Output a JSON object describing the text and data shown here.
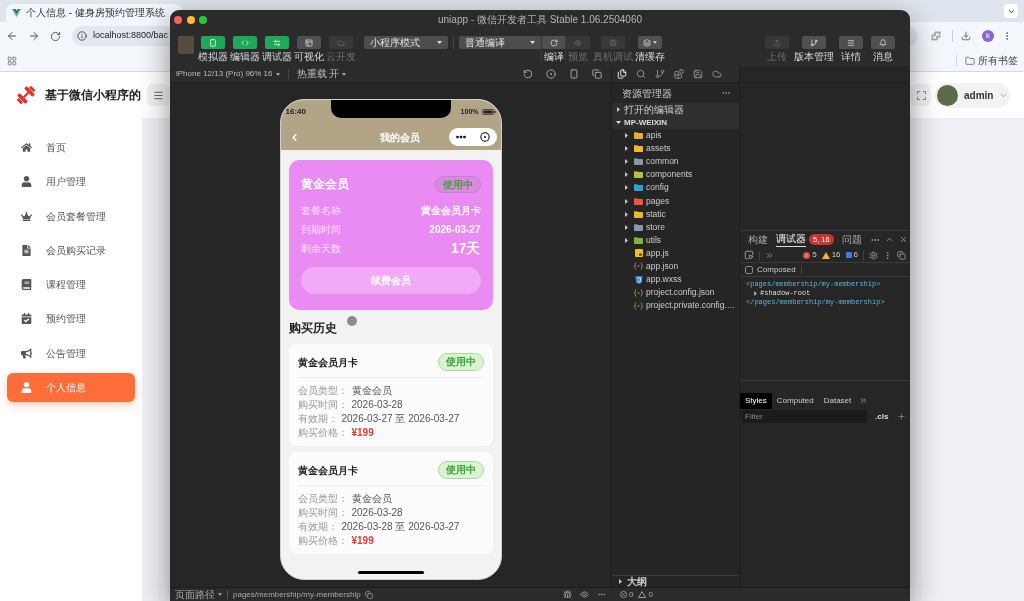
{
  "browser": {
    "tab_title": "个人信息 - 健身房预约管理系统",
    "url": "localhost:8800/bac",
    "profile_initial": "k",
    "bookmarks_folder": "所有书签"
  },
  "app": {
    "title": "基于微信小程序的",
    "user": "admin",
    "menu": [
      {
        "label": "首页",
        "selected": false
      },
      {
        "label": "用户管理",
        "selected": false
      },
      {
        "label": "会员套餐管理",
        "selected": false
      },
      {
        "label": "会员购买记录",
        "selected": false
      },
      {
        "label": "课程管理",
        "selected": false
      },
      {
        "label": "预约管理",
        "selected": false
      },
      {
        "label": "公告管理",
        "selected": false
      },
      {
        "label": "个人信息",
        "selected": true
      }
    ]
  },
  "devtools": {
    "title": "uniapp - 微信开发者工具 Stable 1.06.2504060",
    "toolbar": {
      "view_buttons": [
        {
          "label": "模拟器",
          "on": true,
          "disabled": false
        },
        {
          "label": "编辑器",
          "on": true,
          "disabled": false
        },
        {
          "label": "调试器",
          "on": true,
          "disabled": false
        },
        {
          "label": "可视化",
          "on": false,
          "disabled": false
        },
        {
          "label": "云开发",
          "on": false,
          "disabled": true
        }
      ],
      "mode_select": "小程序模式",
      "compile_select": "普通编译",
      "compile_buttons": [
        {
          "label": "编译",
          "disabled": false
        },
        {
          "label": "预览",
          "disabled": true
        }
      ],
      "debug_buttons": [
        {
          "label": "真机调试",
          "disabled": true
        },
        {
          "label": "清缓存",
          "disabled": false
        }
      ],
      "right_buttons": [
        {
          "label": "上传",
          "disabled": true
        },
        {
          "label": "版本管理",
          "disabled": false
        },
        {
          "label": "详情",
          "disabled": false
        },
        {
          "label": "消息",
          "disabled": false
        }
      ]
    },
    "simulator": {
      "device": "iPhone 12/13 (Pro) 96% 16",
      "hot_reload": "热重载 开",
      "phone": {
        "time": "16:40",
        "battery": "100%",
        "nav_title": "我的会员",
        "membership": {
          "name": "黄金会员",
          "status": "使用中",
          "rows": [
            {
              "label": "套餐名称",
              "value": "黄金会员月卡",
              "kind": "plain"
            },
            {
              "label": "到期时间",
              "value": "2026-03-27",
              "kind": "plain"
            },
            {
              "label": "剩余天数",
              "value": "17天",
              "kind": "large"
            }
          ],
          "button": "续费会员"
        },
        "history_title": "购买历史",
        "history": [
          {
            "title": "黄金会员月卡",
            "status": "使用中",
            "rows": [
              {
                "label": "会员类型：",
                "value": "黄金会员",
                "kind": "plain"
              },
              {
                "label": "购买时间：",
                "value": "2026-03-28",
                "kind": "plain"
              },
              {
                "label": "有效期：",
                "value": "2026-03-27 至 2026-03-27",
                "kind": "plain"
              },
              {
                "label": "购买价格：",
                "value": "¥199",
                "kind": "price"
              }
            ]
          },
          {
            "title": "黄金会员月卡",
            "status": "使用中",
            "rows": [
              {
                "label": "会员类型：",
                "value": "黄金会员",
                "kind": "plain"
              },
              {
                "label": "购买时间：",
                "value": "2026-03-28",
                "kind": "plain"
              },
              {
                "label": "有效期：",
                "value": "2026-03-28 至 2026-03-27",
                "kind": "plain"
              },
              {
                "label": "购买价格：",
                "value": "¥199",
                "kind": "price"
              }
            ]
          }
        ]
      }
    },
    "explorer": {
      "title": "资源管理器",
      "open_editors": {
        "label": "打开的编辑器",
        "expanded": false
      },
      "project": {
        "label": "MP-WEIXIN",
        "expanded": true,
        "children": [
          {
            "name": "apis",
            "kind": "folder",
            "color": "#e9a93b",
            "expanded": false
          },
          {
            "name": "assets",
            "kind": "folder",
            "color": "#f1b533",
            "expanded": false
          },
          {
            "name": "common",
            "kind": "folder",
            "color": "#8797ab",
            "expanded": false
          },
          {
            "name": "components",
            "kind": "folder",
            "color": "#b3c43a",
            "expanded": false
          },
          {
            "name": "config",
            "kind": "folder",
            "color": "#2fa6c8",
            "expanded": false
          },
          {
            "name": "pages",
            "kind": "folder",
            "color": "#e8573e",
            "expanded": false
          },
          {
            "name": "static",
            "kind": "folder",
            "color": "#f0b530",
            "expanded": false
          },
          {
            "name": "store",
            "kind": "folder",
            "color": "#8797ab",
            "expanded": false
          },
          {
            "name": "utils",
            "kind": "folder",
            "color": "#7cb342",
            "expanded": false
          },
          {
            "name": "app.js",
            "kind": "js"
          },
          {
            "name": "app.json",
            "kind": "json"
          },
          {
            "name": "app.wxss",
            "kind": "wxss"
          },
          {
            "name": "project.config.json",
            "kind": "json"
          },
          {
            "name": "project.private.config.…",
            "kind": "json"
          }
        ]
      },
      "outline": {
        "label": "大纲",
        "expanded": false
      }
    },
    "debugger": {
      "tabs": [
        {
          "label": "构建",
          "selected": false
        },
        {
          "label": "调试器",
          "selected": true,
          "badge": "5, 16"
        },
        {
          "label": "问题",
          "selected": false
        }
      ],
      "counts": {
        "errors": "5",
        "warnings": "16",
        "info": "6"
      },
      "composed": {
        "label": "Composed",
        "checked": false
      },
      "elements": [
        {
          "text": "<pages/membership/my-membership>",
          "kind": "tag"
        },
        {
          "text": "#shadow-root",
          "kind": "shadow",
          "expanded": false
        },
        {
          "text": "</pages/membership/my-membership>",
          "kind": "tag"
        }
      ],
      "style_tabs": [
        {
          "label": "Styles",
          "selected": true
        },
        {
          "label": "Computed",
          "selected": false
        },
        {
          "label": "Dataset",
          "selected": false
        }
      ],
      "filter_placeholder": "Filter",
      "cls": ".cls"
    },
    "status_bar": {
      "page_path_label": "页面路径",
      "page_path": "pages/membership/my-membership",
      "errors": "0",
      "warnings": "0"
    }
  }
}
